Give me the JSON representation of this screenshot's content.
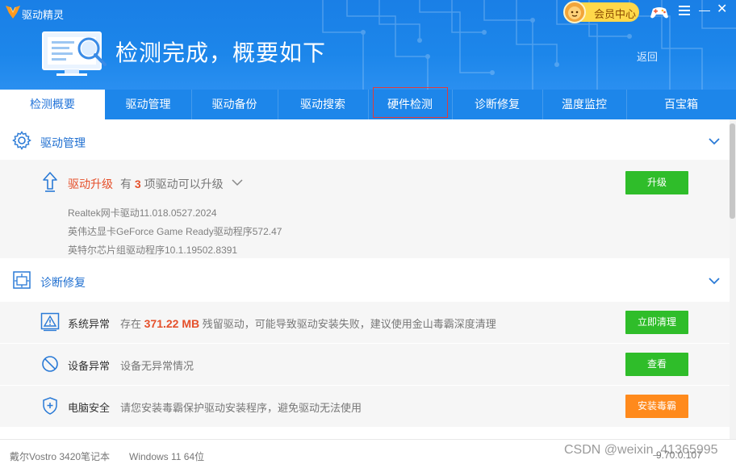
{
  "app": {
    "name": "驱动精灵"
  },
  "header": {
    "vip_label": "会员中心",
    "headline": "检测完成，概要如下",
    "back_label": "返回"
  },
  "tabs": [
    {
      "label": "检测概要",
      "active": true
    },
    {
      "label": "驱动管理"
    },
    {
      "label": "驱动备份"
    },
    {
      "label": "驱动搜索"
    },
    {
      "label": "硬件检测"
    },
    {
      "label": "诊断修复"
    },
    {
      "label": "温度监控"
    },
    {
      "label": "百宝箱"
    }
  ],
  "driver_section": {
    "title": "驱动管理",
    "upgrade": {
      "title": "驱动升级",
      "prefix": "有",
      "count": "3",
      "suffix": "项驱动可以升级",
      "button": "升级"
    },
    "drivers": [
      "Realtek网卡驱动11.018.0527.2024",
      "英伟达显卡GeForce Game Ready驱动程序572.47",
      "英特尔芯片组驱动程序10.1.19502.8391"
    ]
  },
  "diagnose_section": {
    "title": "诊断修复",
    "items": [
      {
        "title": "系统异常",
        "desc_prefix": "存在",
        "desc_value": "371.22 MB",
        "desc_suffix": "残留驱动，可能导致驱动安装失败，建议使用金山毒霸深度清理",
        "button": "立即清理"
      },
      {
        "title": "设备异常",
        "desc": "设备无异常情况",
        "button": "查看"
      },
      {
        "title": "电脑安全",
        "desc": "请您安装毒霸保护驱动安装程序，避免驱动无法使用",
        "button": "安装毒霸"
      }
    ]
  },
  "footer": {
    "device": "戴尔Vostro 3420笔记本",
    "os": "Windows 11 64位",
    "version": "9.70.0.107"
  },
  "watermark": "CSDN @weixin_41365995",
  "colors": {
    "header_blue": "#1c86ea",
    "accent_blue": "#1f6fd0",
    "green_button": "#2fbd2a",
    "orange_button": "#ff8a1c",
    "highlight_red": "#e03b3b",
    "count_red": "#e5502b"
  }
}
